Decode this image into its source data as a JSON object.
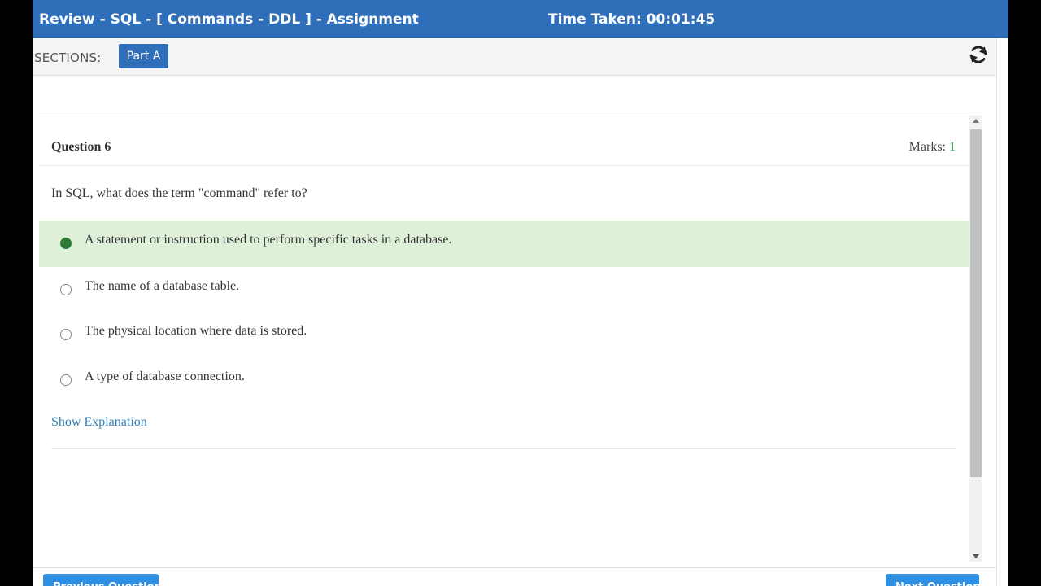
{
  "header": {
    "title": "Review - SQL - [ Commands - DDL ] - Assignment",
    "timer": "Time Taken: 00:01:45"
  },
  "sections": {
    "label": "SECTIONS:",
    "items": [
      {
        "label": "Part A"
      }
    ]
  },
  "question": {
    "title": "Question 6",
    "marks_label": "Marks:",
    "marks_value": "1",
    "text": "In SQL, what does the term \"command\" refer to?",
    "options": [
      {
        "label": "A statement or instruction used to perform specific tasks in a database.",
        "selected": true,
        "correct": true
      },
      {
        "label": "The name of a database table.",
        "selected": false
      },
      {
        "label": "The physical location where data is stored.",
        "selected": false
      },
      {
        "label": "A type of database connection.",
        "selected": false
      }
    ],
    "explanation_link": "Show Explanation"
  },
  "footer": {
    "previous_label": "Previous Question",
    "next_label": "Next Question"
  },
  "icons": {
    "refresh": "refresh-icon"
  },
  "colors": {
    "header_bg": "#2f6fba",
    "correct_bg": "#dff0d8",
    "correct_radio": "#2c7a35",
    "link": "#2f7fb5",
    "marks_value": "#3aa14b",
    "nav_button": "#2f8fe0"
  }
}
